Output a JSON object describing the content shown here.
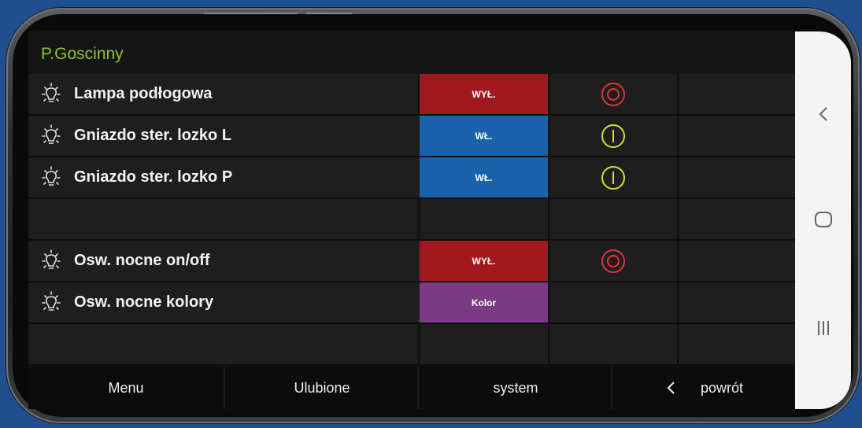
{
  "app": {
    "title": "P.Goscinny"
  },
  "colors": {
    "title": "#8fc32f",
    "off": "#a2181f",
    "on": "#1a63ab",
    "color": "#7a3a84",
    "off_icon": "#e1343a",
    "on_icon": "#d6dd31"
  },
  "rows": [
    {
      "label": "Lampa podłogowa",
      "button": "WYŁ.",
      "state": "off",
      "icon": "lightbulb-icon",
      "status_icon": "power-off-icon"
    },
    {
      "label": "Gniazdo ster. lozko L",
      "button": "WŁ.",
      "state": "on",
      "icon": "lightbulb-icon",
      "status_icon": "power-on-icon"
    },
    {
      "label": "Gniazdo ster. lozko P",
      "button": "WŁ.",
      "state": "on",
      "icon": "lightbulb-icon",
      "status_icon": "power-on-icon"
    },
    {
      "label": "",
      "button": "",
      "state": "empty"
    },
    {
      "label": "Osw. nocne on/off",
      "button": "WYŁ.",
      "state": "off",
      "icon": "lightbulb-icon",
      "status_icon": "power-off-icon"
    },
    {
      "label": "Osw. nocne kolory",
      "button": "Kolor",
      "state": "color",
      "icon": "lightbulb-icon"
    },
    {
      "label": "",
      "button": "",
      "state": "empty"
    }
  ],
  "bottom_nav": {
    "menu": "Menu",
    "favorites": "Ulubione",
    "system": "system",
    "back": "powrót"
  },
  "android_nav": {
    "back_icon": "chevron-left-icon",
    "home_icon": "home-icon",
    "recents_icon": "recents-icon"
  }
}
